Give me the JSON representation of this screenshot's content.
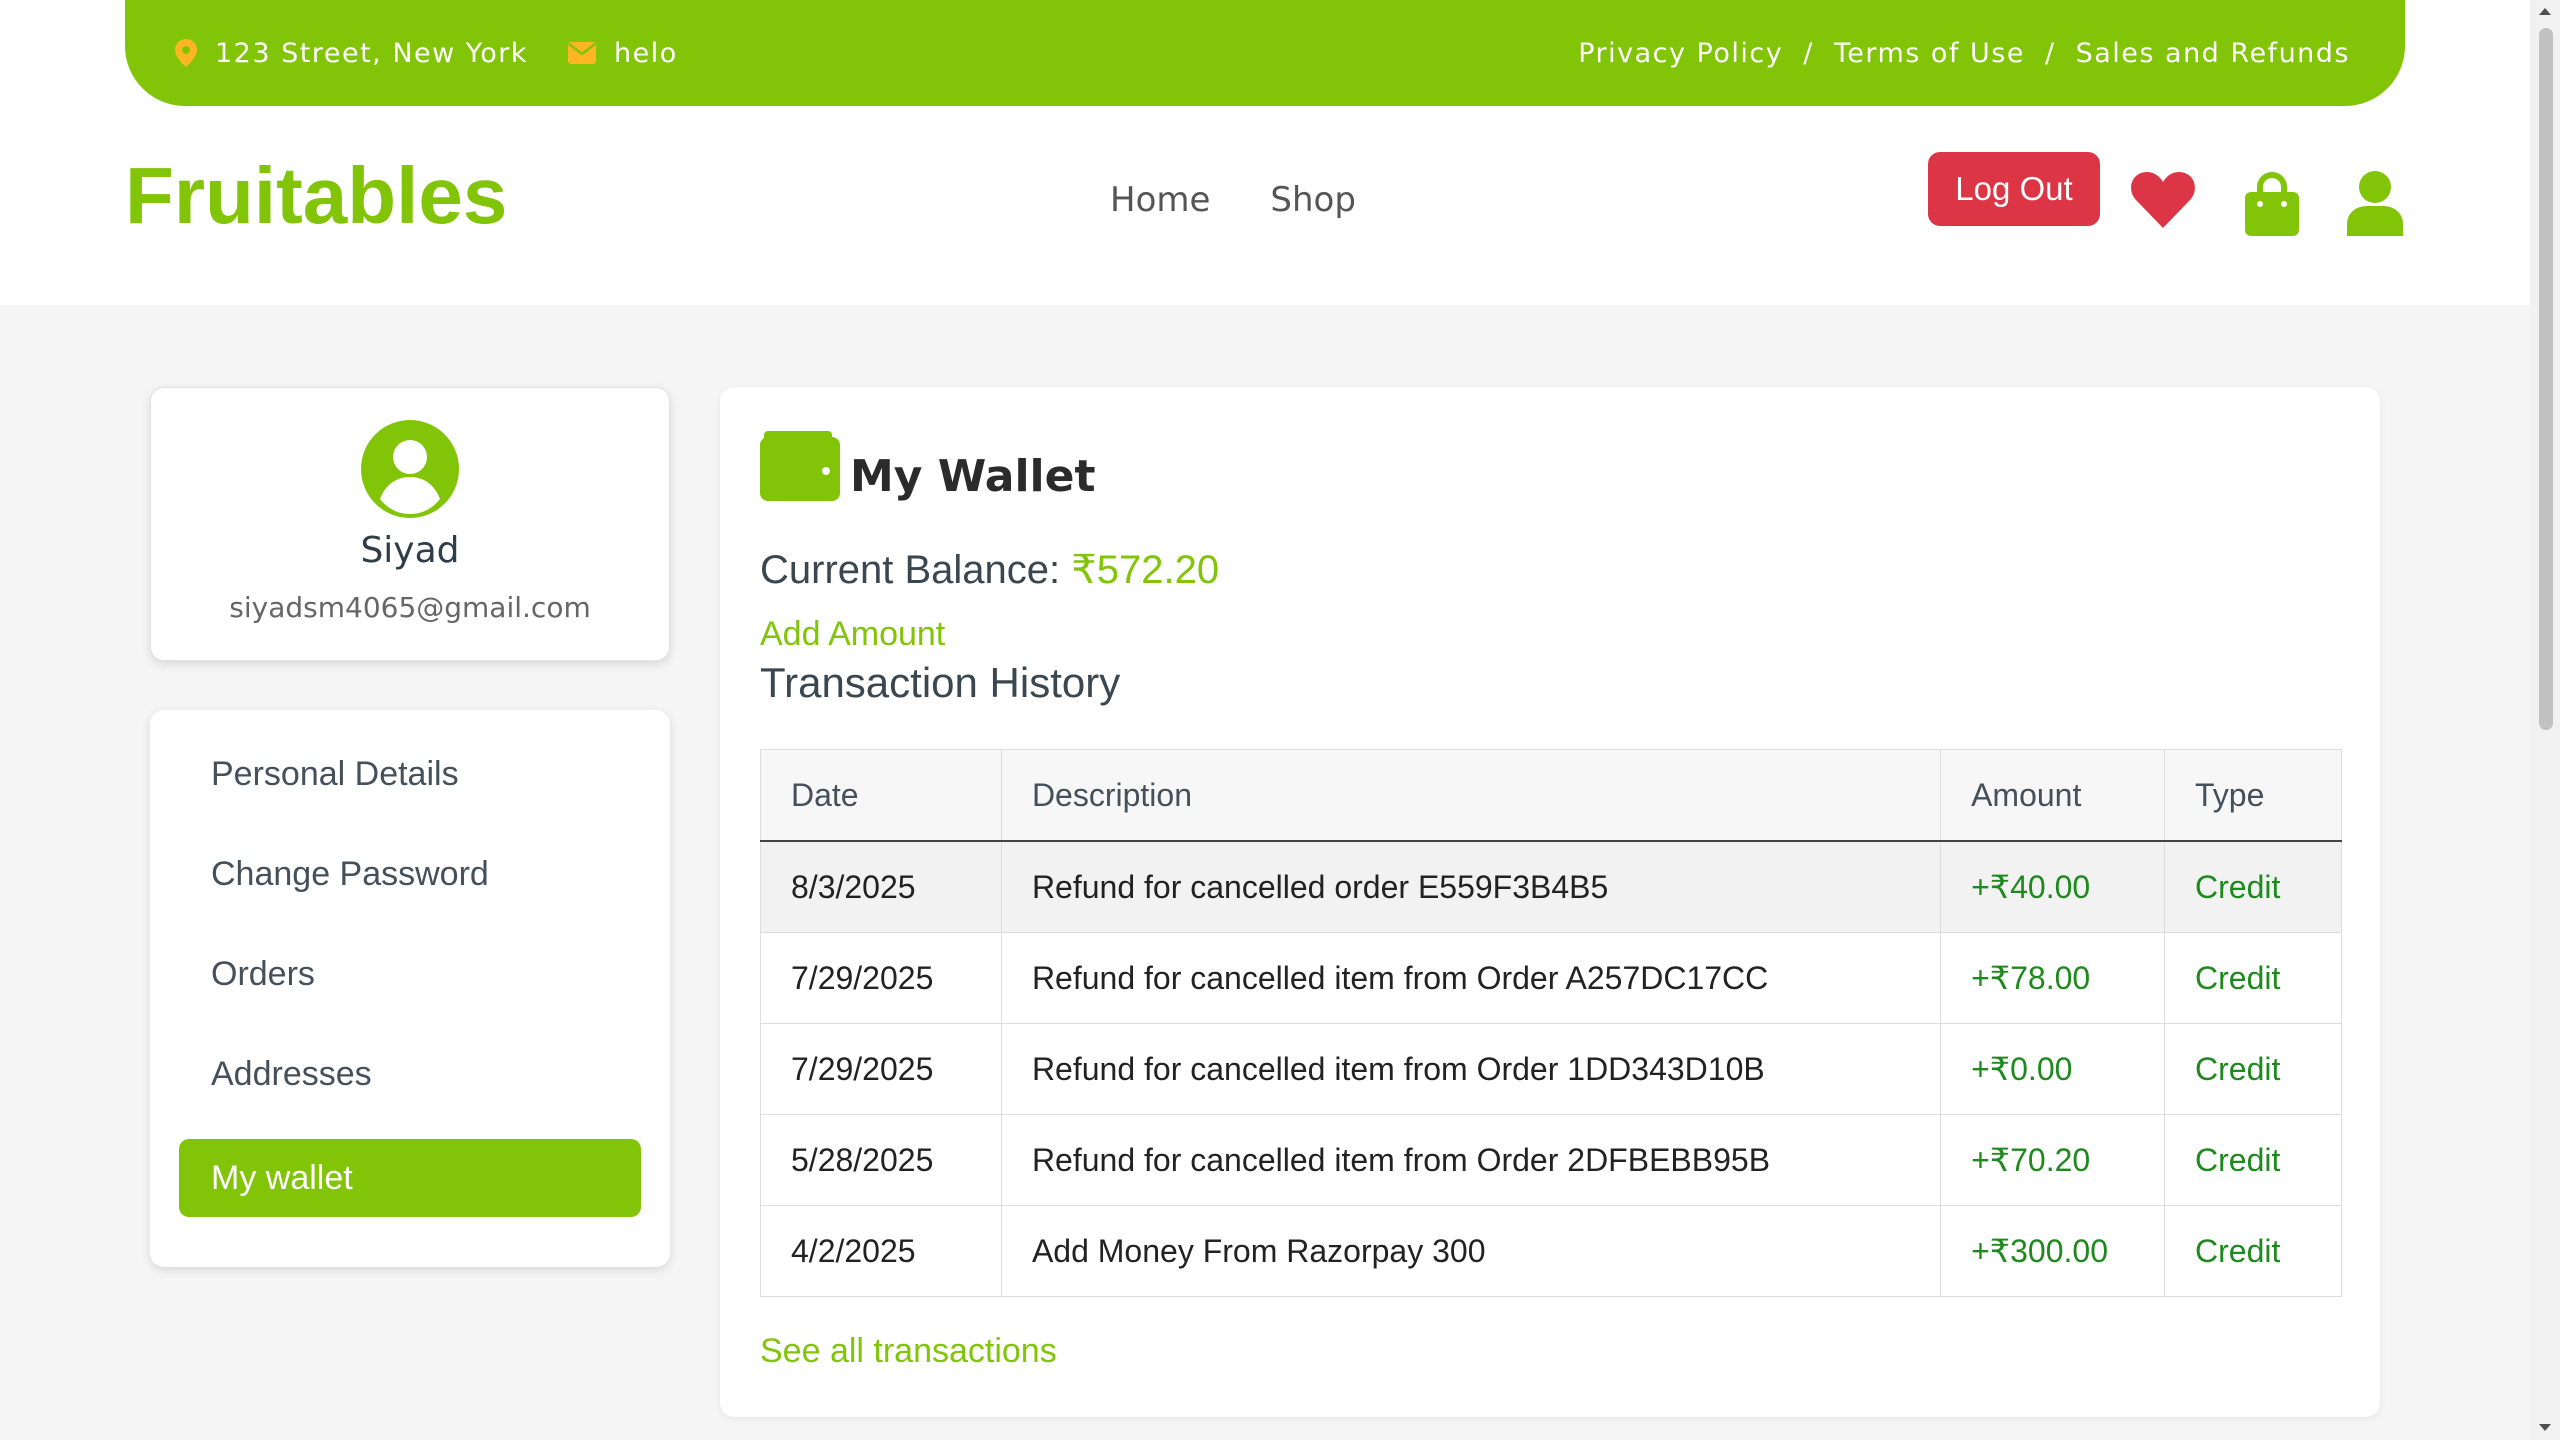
{
  "topbar": {
    "address": "123 Street, New York",
    "email": "helo",
    "links": [
      "Privacy Policy",
      "Terms of Use",
      "Sales and Refunds"
    ],
    "separator": "/"
  },
  "header": {
    "brand": "Fruitables",
    "nav": [
      "Home",
      "Shop"
    ],
    "logout_label": "Log Out"
  },
  "profile": {
    "name": "Siyad",
    "email": "siyadsm4065@gmail.com"
  },
  "sidebar": {
    "items": [
      {
        "label": "Personal Details"
      },
      {
        "label": "Change Password"
      },
      {
        "label": "Orders"
      },
      {
        "label": "Addresses"
      },
      {
        "label": "My wallet",
        "active": true
      }
    ]
  },
  "wallet": {
    "title": "My Wallet",
    "balance_label": "Current Balance:",
    "balance_value": "₹572.20",
    "add_amount": "Add Amount",
    "history_title": "Transaction History",
    "columns": [
      "Date",
      "Description",
      "Amount",
      "Type"
    ],
    "rows": [
      {
        "date": "8/3/2025",
        "description": "Refund for cancelled order E559F3B4B5",
        "amount": "+₹40.00",
        "type": "Credit"
      },
      {
        "date": "7/29/2025",
        "description": "Refund for cancelled item from Order A257DC17CC",
        "amount": "+₹78.00",
        "type": "Credit"
      },
      {
        "date": "7/29/2025",
        "description": "Refund for cancelled item from Order 1DD343D10B",
        "amount": "+₹0.00",
        "type": "Credit"
      },
      {
        "date": "5/28/2025",
        "description": "Refund for cancelled item from Order 2DFBEBB95B",
        "amount": "+₹70.20",
        "type": "Credit"
      },
      {
        "date": "4/2/2025",
        "description": "Add Money From Razorpay 300",
        "amount": "+₹300.00",
        "type": "Credit"
      }
    ],
    "see_all": "See all transactions"
  },
  "colors": {
    "brand": "#81c408",
    "danger": "#dc3545",
    "credit": "#1e8a1e",
    "topbar_icon": "#ffb524"
  },
  "icons": [
    "map-pin-icon",
    "envelope-icon",
    "heart-icon",
    "shopping-bag-icon",
    "user-icon",
    "user-circle-icon",
    "wallet-icon"
  ]
}
